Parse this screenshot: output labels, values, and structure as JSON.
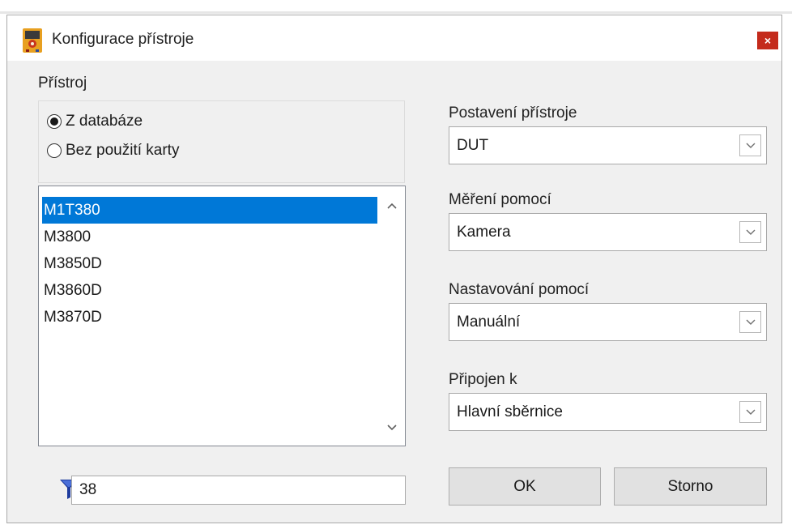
{
  "window": {
    "title": "Konfigurace přístroje",
    "close_glyph": "×",
    "icon": "app-multimeter-icon"
  },
  "device_group": {
    "label": "Přístroj",
    "options": [
      {
        "label": "Z databáze",
        "selected": true
      },
      {
        "label": "Bez použití karty",
        "selected": false
      }
    ]
  },
  "device_list": {
    "items": [
      "M1T380",
      "M3800",
      "M3850D",
      "M3860D",
      "M3870D"
    ],
    "selected_index": 0
  },
  "filter": {
    "icon": "filter-icon",
    "value": "38"
  },
  "fields": [
    {
      "label": "Postavení přístroje",
      "value": "DUT"
    },
    {
      "label": "Měření pomocí",
      "value": "Kamera"
    },
    {
      "label": "Nastavování pomocí",
      "value": "Manuální"
    },
    {
      "label": "Připojen k",
      "value": "Hlavní sběrnice"
    }
  ],
  "buttons": {
    "ok": "OK",
    "cancel": "Storno"
  },
  "colors": {
    "selection": "#0078d7",
    "close": "#c42b1c",
    "filter_icon": "#1f3c9e"
  }
}
